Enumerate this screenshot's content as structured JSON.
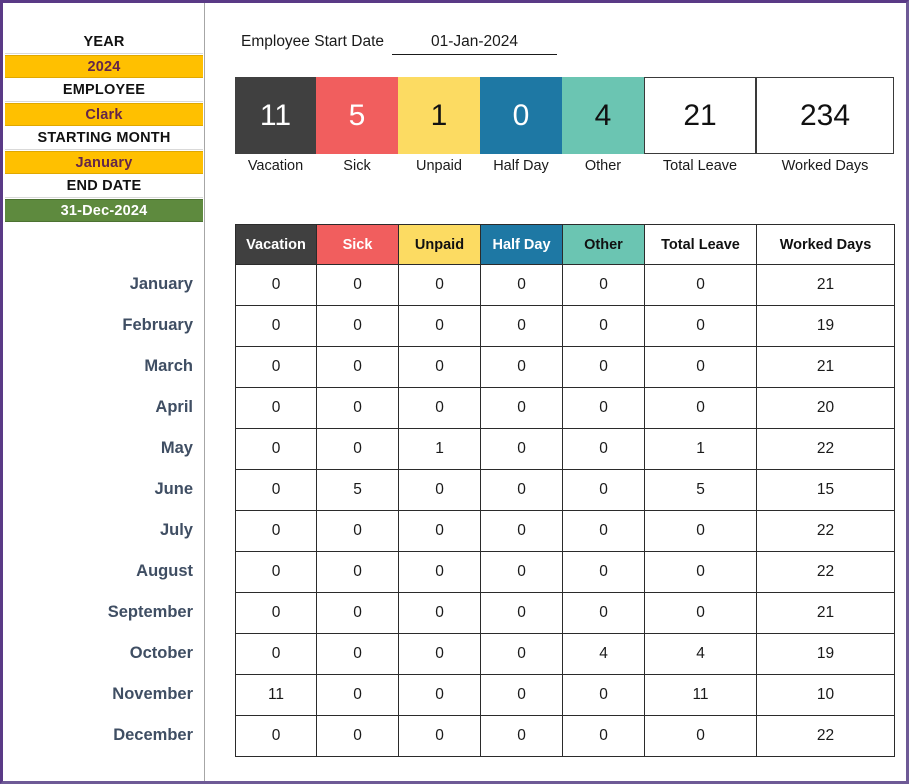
{
  "sidebar": {
    "fields": [
      {
        "label": "YEAR",
        "value": "2024",
        "value_style": "amber"
      },
      {
        "label": "EMPLOYEE",
        "value": "Clark",
        "value_style": "amber"
      },
      {
        "label": "STARTING MONTH",
        "value": "January",
        "value_style": "amber"
      },
      {
        "label": "END DATE",
        "value": "31-Dec-2024",
        "value_style": "green"
      }
    ],
    "months": [
      "January",
      "February",
      "March",
      "April",
      "May",
      "June",
      "July",
      "August",
      "September",
      "October",
      "November",
      "December"
    ]
  },
  "start_date": {
    "label": "Employee Start Date",
    "value": "01-Jan-2024"
  },
  "summary": {
    "cards": [
      {
        "caption": "Vacation",
        "value": "11",
        "bg": "#404040",
        "fg": "#ffffff"
      },
      {
        "caption": "Sick",
        "value": "5",
        "bg": "#F15E5E",
        "fg": "#ffffff"
      },
      {
        "caption": "Unpaid",
        "value": "1",
        "bg": "#FCDB62",
        "fg": "#111111"
      },
      {
        "caption": "Half Day",
        "value": "0",
        "bg": "#1E78A4",
        "fg": "#ffffff"
      },
      {
        "caption": "Other",
        "value": "4",
        "bg": "#6BC5B2",
        "fg": "#111111"
      },
      {
        "caption": "Total Leave",
        "value": "21",
        "bg": "#ffffff",
        "fg": "#111111"
      },
      {
        "caption": "Worked Days",
        "value": "234",
        "bg": "#ffffff",
        "fg": "#111111"
      }
    ]
  },
  "chart_data": {
    "type": "table",
    "title": "Monthly Leave Tracker",
    "columns": [
      {
        "label": "Vacation",
        "bg": "#404040",
        "fg": "#ffffff"
      },
      {
        "label": "Sick",
        "bg": "#F15E5E",
        "fg": "#ffffff"
      },
      {
        "label": "Unpaid",
        "bg": "#FCDB62",
        "fg": "#111111"
      },
      {
        "label": "Half Day",
        "bg": "#1E78A4",
        "fg": "#ffffff"
      },
      {
        "label": "Other",
        "bg": "#6BC5B2",
        "fg": "#111111"
      },
      {
        "label": "Total Leave",
        "bg": "#ffffff",
        "fg": "#111111"
      },
      {
        "label": "Worked Days",
        "bg": "#ffffff",
        "fg": "#111111"
      }
    ],
    "categories": [
      "January",
      "February",
      "March",
      "April",
      "May",
      "June",
      "July",
      "August",
      "September",
      "October",
      "November",
      "December"
    ],
    "series": [
      {
        "name": "Vacation",
        "values": [
          0,
          0,
          0,
          0,
          0,
          0,
          0,
          0,
          0,
          0,
          11,
          0
        ]
      },
      {
        "name": "Sick",
        "values": [
          0,
          0,
          0,
          0,
          0,
          5,
          0,
          0,
          0,
          0,
          0,
          0
        ]
      },
      {
        "name": "Unpaid",
        "values": [
          0,
          0,
          0,
          0,
          1,
          0,
          0,
          0,
          0,
          0,
          0,
          0
        ]
      },
      {
        "name": "Half Day",
        "values": [
          0,
          0,
          0,
          0,
          0,
          0,
          0,
          0,
          0,
          0,
          0,
          0
        ]
      },
      {
        "name": "Other",
        "values": [
          0,
          0,
          0,
          0,
          0,
          0,
          0,
          0,
          0,
          4,
          0,
          0
        ]
      },
      {
        "name": "Total Leave",
        "values": [
          0,
          0,
          0,
          0,
          1,
          5,
          0,
          0,
          0,
          4,
          11,
          0
        ]
      },
      {
        "name": "Worked Days",
        "values": [
          21,
          19,
          21,
          20,
          22,
          15,
          22,
          22,
          21,
          19,
          10,
          22
        ]
      }
    ],
    "rows": [
      {
        "month": "January",
        "cells": [
          0,
          0,
          0,
          0,
          0,
          0,
          21
        ]
      },
      {
        "month": "February",
        "cells": [
          0,
          0,
          0,
          0,
          0,
          0,
          19
        ]
      },
      {
        "month": "March",
        "cells": [
          0,
          0,
          0,
          0,
          0,
          0,
          21
        ]
      },
      {
        "month": "April",
        "cells": [
          0,
          0,
          0,
          0,
          0,
          0,
          20
        ]
      },
      {
        "month": "May",
        "cells": [
          0,
          0,
          1,
          0,
          0,
          1,
          22
        ]
      },
      {
        "month": "June",
        "cells": [
          0,
          5,
          0,
          0,
          0,
          5,
          15
        ]
      },
      {
        "month": "July",
        "cells": [
          0,
          0,
          0,
          0,
          0,
          0,
          22
        ]
      },
      {
        "month": "August",
        "cells": [
          0,
          0,
          0,
          0,
          0,
          0,
          22
        ]
      },
      {
        "month": "September",
        "cells": [
          0,
          0,
          0,
          0,
          0,
          0,
          21
        ]
      },
      {
        "month": "October",
        "cells": [
          0,
          0,
          0,
          0,
          4,
          4,
          19
        ]
      },
      {
        "month": "November",
        "cells": [
          11,
          0,
          0,
          0,
          0,
          11,
          10
        ]
      },
      {
        "month": "December",
        "cells": [
          0,
          0,
          0,
          0,
          0,
          0,
          22
        ]
      }
    ]
  },
  "colors": {
    "amber": "#FFC000",
    "amber_text": "#63264a",
    "green": "#5E8A3E",
    "month_text": "#3f4e63",
    "frame": "#5a3a86"
  }
}
